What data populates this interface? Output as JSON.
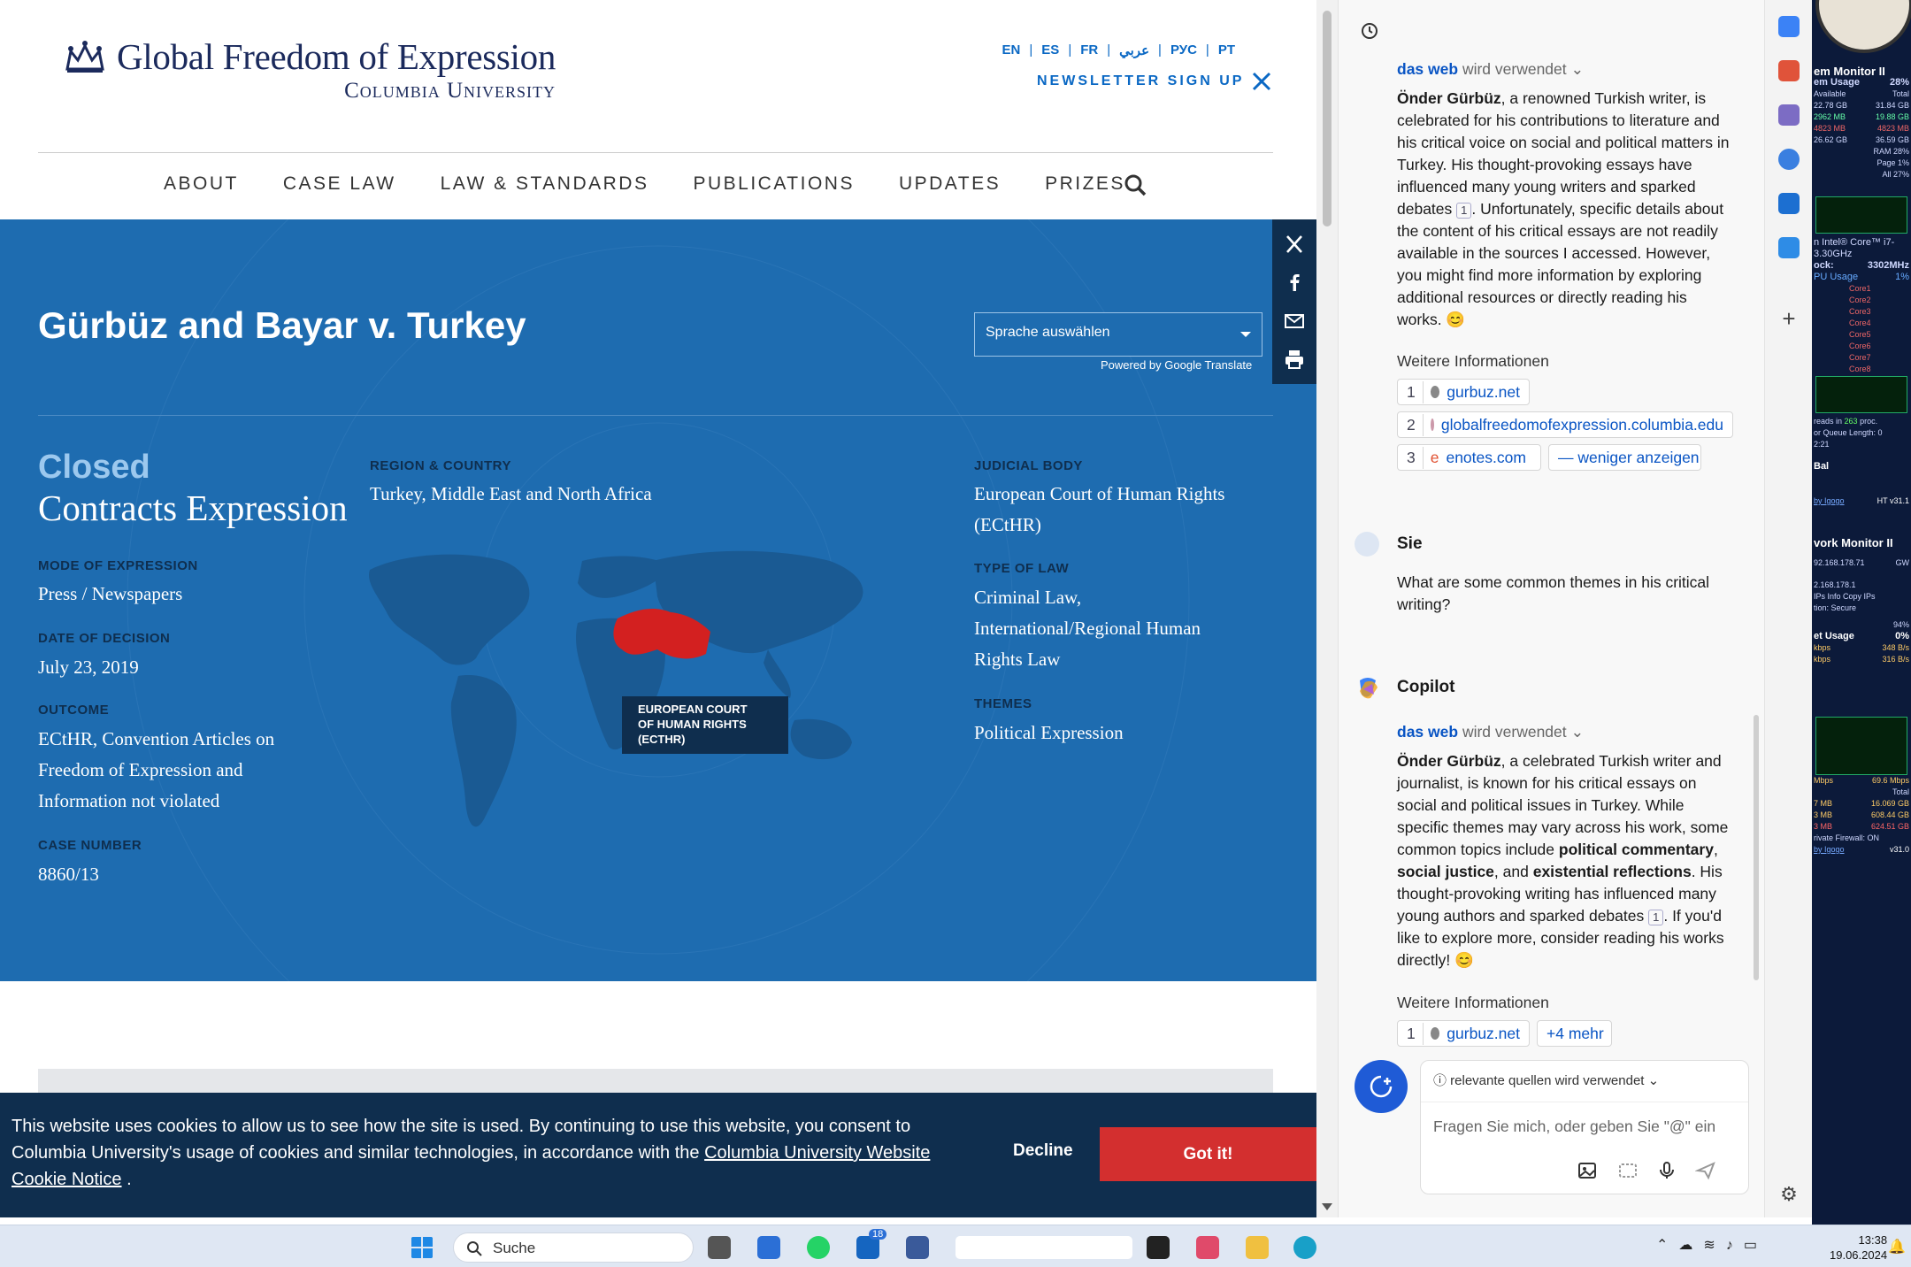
{
  "site": {
    "logo": {
      "line1": "Global Freedom of Expression",
      "line2": "Columbia University"
    },
    "languages": [
      "EN",
      "ES",
      "FR",
      "عربي",
      "РУС",
      "PT"
    ],
    "newsletter": "NEWSLETTER SIGN UP",
    "nav": [
      "ABOUT",
      "CASE LAW",
      "LAW & STANDARDS",
      "PUBLICATIONS",
      "UPDATES",
      "PRIZES"
    ],
    "title": "Gürbüz and Bayar v. Turkey",
    "lang_select": "Sprache auswählen",
    "powered": "Powered by Google Translate",
    "status": "Closed",
    "subtitle": "Contracts Expression",
    "mode_label": "MODE OF EXPRESSION",
    "mode": "Press / Newspapers",
    "date_label": "DATE OF DECISION",
    "date": "July 23, 2019",
    "outcome_label": "OUTCOME",
    "outcome": [
      "ECtHR, Convention Articles on",
      "Freedom of Expression and",
      "Information not violated"
    ],
    "case_label": "CASE NUMBER",
    "case": "8860/13",
    "region_label": "REGION & COUNTRY",
    "region": "Turkey, Middle East and North Africa",
    "map_label": [
      "EUROPEAN COURT",
      "OF HUMAN RIGHTS",
      "(ECTHR)"
    ],
    "body_label": "JUDICIAL BODY",
    "body": [
      "European Court of Human Rights",
      "(ECtHR)"
    ],
    "law_label": "TYPE OF LAW",
    "law": [
      "Criminal Law,",
      "International/Regional Human",
      "Rights Law"
    ],
    "themes_label": "THEMES",
    "themes": "Political Expression",
    "cookie": {
      "text": "This website uses cookies to allow us to see how the site is used. By continuing to use this website, you consent to Columbia University's usage of cookies and similar technologies, in accordance with the ",
      "link": "Columbia University Website Cookie Notice",
      "end": " .",
      "decline": "Decline",
      "accept": "Got it!"
    }
  },
  "copilot": {
    "web": "das web",
    "used": "wird verwendet",
    "a1": {
      "bold": "Önder Gürbüz",
      "text": ", a renowned Turkish writer, is celebrated for his contributions to literature and his critical voice on social and political matters in Turkey. His thought-provoking essays have influenced many young writers and sparked debates",
      "text2": ". Unfortunately, specific details about the content of his critical essays are not readily available in the sources I accessed. However, you might find more information by exploring additional resources or directly reading his works. 😊"
    },
    "more": "Weitere Informationen",
    "sources": [
      {
        "n": "1",
        "name": "gurbuz.net"
      },
      {
        "n": "2",
        "name": "globalfreedomofexpression.columbia.edu"
      },
      {
        "n": "3",
        "name": "enotes.com"
      }
    ],
    "less": "— weniger anzeigen",
    "user": "Sie",
    "question": "What are some common themes in his critical writing?",
    "bot": "Copilot",
    "a2": {
      "bold": "Önder Gürbüz",
      "p1": ", a celebrated Turkish writer and journalist, is known for his critical essays on social and political issues in Turkey. While specific themes may vary across his work, some common topics include ",
      "b1": "political commentary",
      "p2": ", ",
      "b2": "social justice",
      "p3": ", and ",
      "b3": "existential reflections",
      "p4": ". His thought-provoking writing has influenced many young authors and sparked debates",
      "p5": ". If you'd like to explore more, consider reading his works directly! 😊"
    },
    "cite1": "1",
    "more2": "+4 mehr",
    "relevant": "relevante quellen wird verwendet",
    "placeholder": "Fragen Sie mich, oder geben Sie \"@\" ein"
  },
  "widget": {
    "sys": "em Monitor II",
    "usage": "em Usage",
    "pct": "28%",
    "avail": "Available",
    "total": "Total",
    "r1": "22.78 GB",
    "r1b": "31.84 GB",
    "r2": "2962 MB",
    "r2b": "19.88 GB",
    "r3": "4823 MB",
    "r3b": "4823 MB",
    "r4": "26.62 GB",
    "r4b": "36.59 GB",
    "ram": "RAM 28%",
    "page": "Page 1%",
    "all": "All 27%",
    "cpu": "n Intel® Core™ i7-",
    "ghz": "3.30GHz",
    "clock": "ock:",
    "mhz": "3302MHz",
    "cpuu": "PU Usage",
    "cpup": "1%",
    "cores": [
      "Core1",
      "Core2",
      "Core3",
      "Core4",
      "Core5",
      "Core6",
      "Core7",
      "Core8"
    ],
    "threads": "reads in",
    "proc": "263",
    "procs": "proc.",
    "queue": "or Queue Length: 0",
    "time": "2:21",
    "bal": "Bal",
    "brand": "by Igogo",
    "ver": "HT v31.1",
    "net": "vork Monitor II",
    "ip1": "92.168.178.71",
    "gw": "GW",
    "ip2": "2.168.178.1",
    "ips": "IPs  Info  Copy IPs",
    "sec": "tion: Secure",
    "p94": "94%",
    "nu": "et Usage",
    "p0": "0%",
    "k1": "kbps",
    "k1v": "348 B/s",
    "k2": "kbps",
    "k2v": "316 B/s",
    "mbps": "Mbps",
    "mbv": "69.6 Mbps",
    "tot": "Total",
    "m1": "7 MB",
    "m1v": "16.069 GB",
    "m2": "3 MB",
    "m2v": "608.44 GB",
    "m3": "3 MB",
    "m3v": "624.51 GB",
    "fw": "rivate  Firewall: ON",
    "ver2": "v31.0"
  },
  "taskbar": {
    "search": "Suche",
    "badge": "18",
    "time": "13:38",
    "date": "19.06.2024"
  }
}
